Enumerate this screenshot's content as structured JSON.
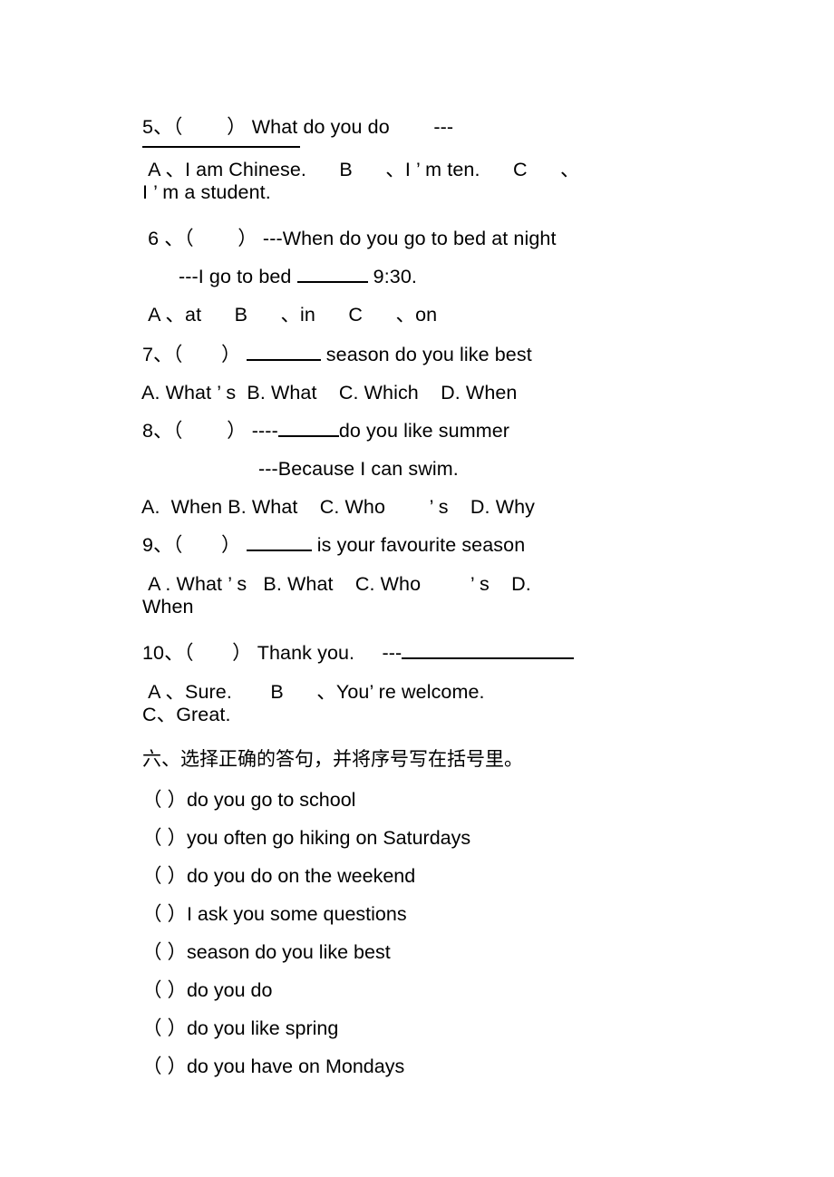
{
  "document": {
    "type": "exam-worksheet",
    "language": "en-zh"
  },
  "multiple_choice": {
    "items": [
      {
        "id": "q5",
        "number": "5、",
        "paren": "（        ）",
        "stem": " What do you do        ---",
        "has_trailing_rule": true,
        "options_lines": [
          " A 、I am Chinese.      B      、I ’ m ten.      C      、",
          "I ’ m a student."
        ]
      },
      {
        "id": "q6",
        "number": " 6 、",
        "paren": "（        ）",
        "stem": " ---When do you go to bed at night",
        "second_line_prefix": "---I go to bed ",
        "second_line_suffix": " 9:30.",
        "options_lines": [
          " A 、at      B      、in      C      、on"
        ]
      },
      {
        "id": "q7",
        "number": "7、",
        "paren": "（       ）",
        "stem_prefix": " ",
        "stem_suffix": " season do you like best",
        "options_lines": [
          "A. What ’ s  B. What    C. Which    D. When"
        ]
      },
      {
        "id": "q8",
        "number": "8、",
        "paren": "（        ）",
        "stem_prefix": " ----",
        "stem_suffix": "do you like summer",
        "second_line": "---Because I can swim.",
        "options_lines": [
          "A.  When B. What    C. Who        ’ s    D. Why"
        ]
      },
      {
        "id": "q9",
        "number": "9、",
        "paren": "（       ）",
        "stem_prefix": " ",
        "stem_suffix": " is your favourite season",
        "options_lines": [
          " A . What ’ s   B. What    C. Who         ’ s    D.",
          "When"
        ]
      },
      {
        "id": "q10",
        "number": "10、",
        "paren": "（       ）",
        "stem": " Thank you.     ---",
        "has_trailing_blank": true,
        "options_lines": [
          " A 、Sure.       B      、You’ re welcome.",
          "C、Great."
        ]
      }
    ]
  },
  "section_six": {
    "heading": "六、选择正确的答句，并将序号写在括号里。",
    "items": [
      "（ ）do you go to school",
      "（ ）you often go hiking on Saturdays",
      "（ ）do you do on the weekend",
      "（ ）I ask you some questions",
      "（ ）season do you like best",
      "（ ）do you do",
      "（ ）do you like spring",
      "（ ）do you have on Mondays"
    ]
  },
  "colors": {
    "text": "#000000",
    "background": "#ffffff",
    "rule": "#000000"
  }
}
